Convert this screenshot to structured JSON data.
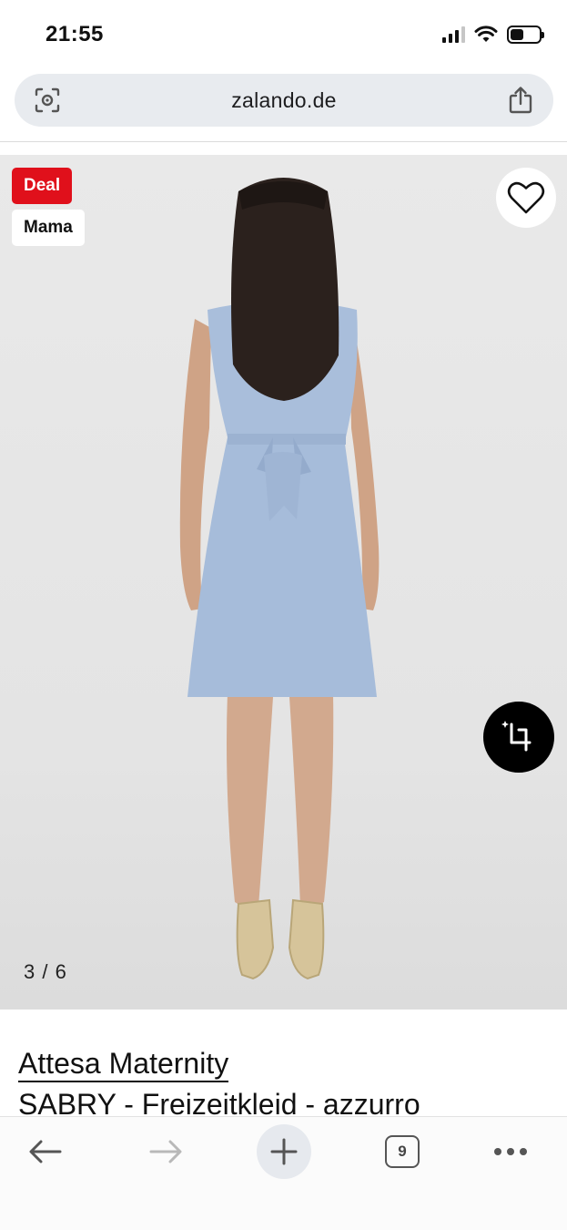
{
  "status_bar": {
    "time": "21:55",
    "icons": [
      "cellular-signal-icon",
      "wifi-icon",
      "battery-icon"
    ]
  },
  "browser": {
    "url": "zalando.de",
    "left_icon": "visual-search-icon",
    "right_icon": "share-icon",
    "toolbar": {
      "back_icon": "arrow-left-icon",
      "forward_icon": "arrow-right-icon",
      "new_tab_icon": "plus-icon",
      "tab_count": "9",
      "more_icon": "more-dots-icon"
    }
  },
  "product": {
    "badges": {
      "deal": "Deal",
      "mama": "Mama"
    },
    "image_counter": "3 / 6",
    "brand": "Attesa Maternity",
    "name": "SABRY - Freizeitkleid - azzurro"
  },
  "colors": {
    "deal_badge": "#e0101b",
    "dress": "#a9bedb",
    "url_bar": "#e8ebef"
  }
}
